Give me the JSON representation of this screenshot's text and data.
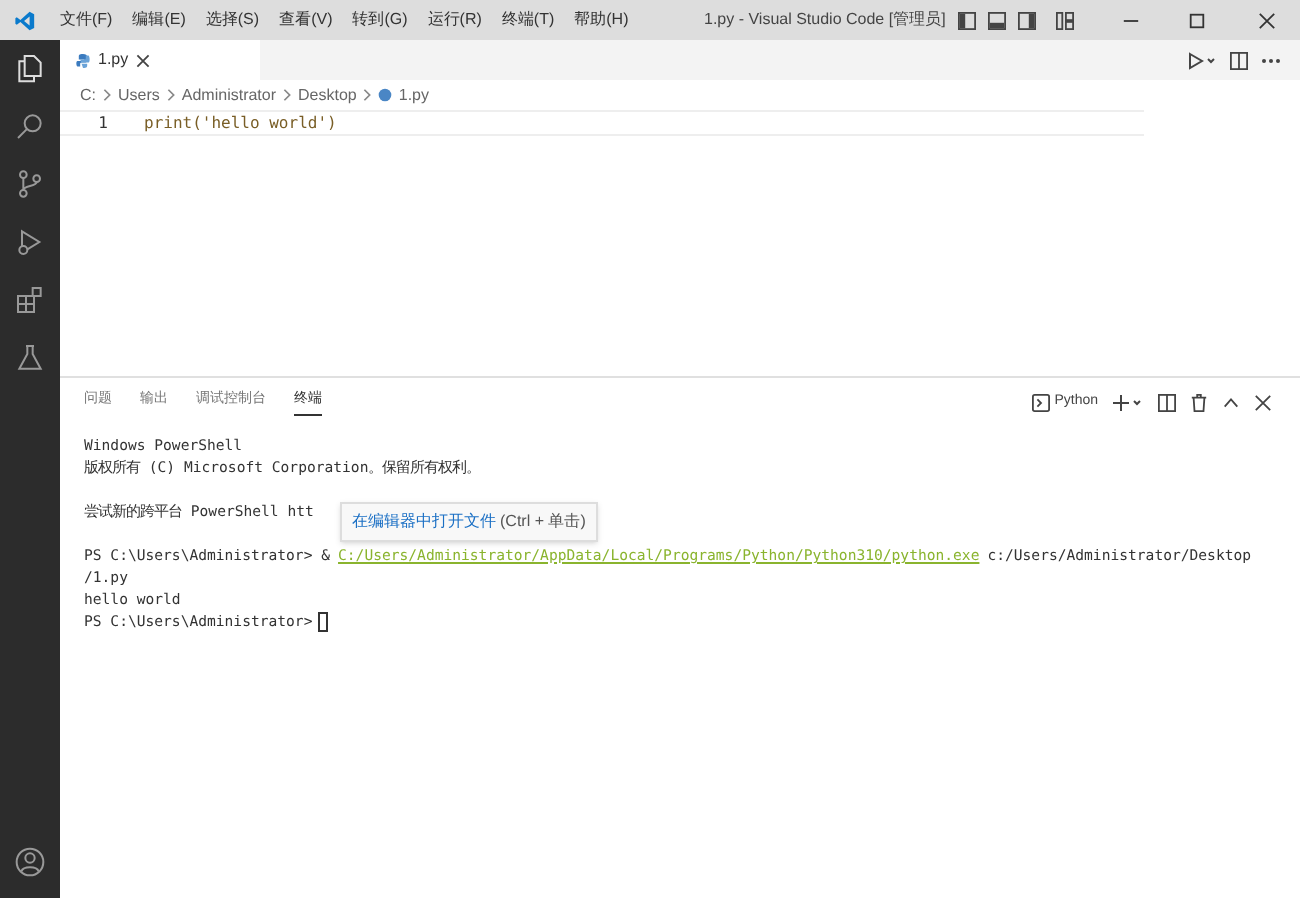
{
  "window": {
    "title": "1.py - Visual Studio Code [管理员]"
  },
  "menu": [
    "文件(F)",
    "编辑(E)",
    "选择(S)",
    "查看(V)",
    "转到(G)",
    "运行(R)",
    "终端(T)",
    "帮助(H)"
  ],
  "tabs": [
    {
      "label": "1.py",
      "selected": true
    }
  ],
  "breadcrumb": [
    "C:",
    "Users",
    "Administrator",
    "Desktop",
    "1.py"
  ],
  "editor": {
    "lines": [
      {
        "number": "1",
        "code": "print('hello world')"
      }
    ]
  },
  "panel": {
    "tabs": [
      {
        "label": "问题",
        "selected": false
      },
      {
        "label": "输出",
        "selected": false
      },
      {
        "label": "调试控制台",
        "selected": false
      },
      {
        "label": "终端",
        "selected": true
      }
    ],
    "terminal_name": "Python",
    "terminal": [
      {
        "kind": "text",
        "text": "Windows PowerShell"
      },
      {
        "kind": "text",
        "text": "版权所有 (C) Microsoft Corporation。保留所有权利。"
      },
      {
        "kind": "blank"
      },
      {
        "kind": "text",
        "text": "尝试新的跨平台 PowerShell htt"
      },
      {
        "kind": "blank"
      },
      {
        "kind": "command",
        "prompt": "PS C:\\Users\\Administrator> &",
        "link": "C:/Users/Administrator/AppData/Local/Programs/Python/Python310/python.exe",
        "rest": "c:/Users/Administrator/Desktop"
      },
      {
        "kind": "text",
        "text": "/1.py"
      },
      {
        "kind": "text",
        "text": "hello world"
      },
      {
        "kind": "cursor",
        "prompt": "PS C:\\Users\\Administrator>"
      }
    ],
    "tooltip": {
      "label": "在编辑器中打开文件",
      "shortcut": "(Ctrl + 单击)"
    }
  }
}
